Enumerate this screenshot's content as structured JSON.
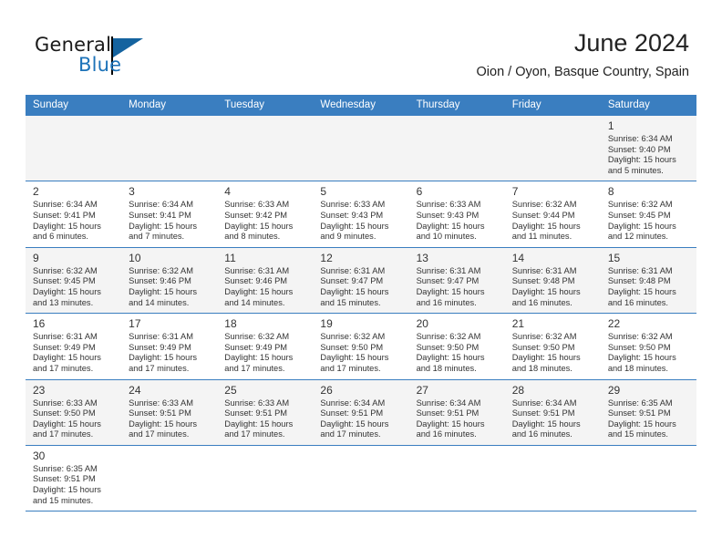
{
  "brand": {
    "word_one": "General",
    "word_two": "Blue",
    "flag_icon": "flag-icon"
  },
  "header": {
    "title": "June 2024",
    "subtitle": "Oion / Oyon, Basque Country, Spain"
  },
  "colors": {
    "header_blue": "#3a7ec0",
    "brand_blue": "#1c72b8",
    "alt_row": "#f4f4f4",
    "text": "#333333"
  },
  "calendar": {
    "weekday_headers": [
      "Sunday",
      "Monday",
      "Tuesday",
      "Wednesday",
      "Thursday",
      "Friday",
      "Saturday"
    ],
    "weeks": [
      [
        {
          "day": "",
          "sunrise": "",
          "sunset": "",
          "daylight_1": "",
          "daylight_2": ""
        },
        {
          "day": "",
          "sunrise": "",
          "sunset": "",
          "daylight_1": "",
          "daylight_2": ""
        },
        {
          "day": "",
          "sunrise": "",
          "sunset": "",
          "daylight_1": "",
          "daylight_2": ""
        },
        {
          "day": "",
          "sunrise": "",
          "sunset": "",
          "daylight_1": "",
          "daylight_2": ""
        },
        {
          "day": "",
          "sunrise": "",
          "sunset": "",
          "daylight_1": "",
          "daylight_2": ""
        },
        {
          "day": "",
          "sunrise": "",
          "sunset": "",
          "daylight_1": "",
          "daylight_2": ""
        },
        {
          "day": "1",
          "sunrise": "Sunrise: 6:34 AM",
          "sunset": "Sunset: 9:40 PM",
          "daylight_1": "Daylight: 15 hours",
          "daylight_2": "and 5 minutes."
        }
      ],
      [
        {
          "day": "2",
          "sunrise": "Sunrise: 6:34 AM",
          "sunset": "Sunset: 9:41 PM",
          "daylight_1": "Daylight: 15 hours",
          "daylight_2": "and 6 minutes."
        },
        {
          "day": "3",
          "sunrise": "Sunrise: 6:34 AM",
          "sunset": "Sunset: 9:41 PM",
          "daylight_1": "Daylight: 15 hours",
          "daylight_2": "and 7 minutes."
        },
        {
          "day": "4",
          "sunrise": "Sunrise: 6:33 AM",
          "sunset": "Sunset: 9:42 PM",
          "daylight_1": "Daylight: 15 hours",
          "daylight_2": "and 8 minutes."
        },
        {
          "day": "5",
          "sunrise": "Sunrise: 6:33 AM",
          "sunset": "Sunset: 9:43 PM",
          "daylight_1": "Daylight: 15 hours",
          "daylight_2": "and 9 minutes."
        },
        {
          "day": "6",
          "sunrise": "Sunrise: 6:33 AM",
          "sunset": "Sunset: 9:43 PM",
          "daylight_1": "Daylight: 15 hours",
          "daylight_2": "and 10 minutes."
        },
        {
          "day": "7",
          "sunrise": "Sunrise: 6:32 AM",
          "sunset": "Sunset: 9:44 PM",
          "daylight_1": "Daylight: 15 hours",
          "daylight_2": "and 11 minutes."
        },
        {
          "day": "8",
          "sunrise": "Sunrise: 6:32 AM",
          "sunset": "Sunset: 9:45 PM",
          "daylight_1": "Daylight: 15 hours",
          "daylight_2": "and 12 minutes."
        }
      ],
      [
        {
          "day": "9",
          "sunrise": "Sunrise: 6:32 AM",
          "sunset": "Sunset: 9:45 PM",
          "daylight_1": "Daylight: 15 hours",
          "daylight_2": "and 13 minutes."
        },
        {
          "day": "10",
          "sunrise": "Sunrise: 6:32 AM",
          "sunset": "Sunset: 9:46 PM",
          "daylight_1": "Daylight: 15 hours",
          "daylight_2": "and 14 minutes."
        },
        {
          "day": "11",
          "sunrise": "Sunrise: 6:31 AM",
          "sunset": "Sunset: 9:46 PM",
          "daylight_1": "Daylight: 15 hours",
          "daylight_2": "and 14 minutes."
        },
        {
          "day": "12",
          "sunrise": "Sunrise: 6:31 AM",
          "sunset": "Sunset: 9:47 PM",
          "daylight_1": "Daylight: 15 hours",
          "daylight_2": "and 15 minutes."
        },
        {
          "day": "13",
          "sunrise": "Sunrise: 6:31 AM",
          "sunset": "Sunset: 9:47 PM",
          "daylight_1": "Daylight: 15 hours",
          "daylight_2": "and 16 minutes."
        },
        {
          "day": "14",
          "sunrise": "Sunrise: 6:31 AM",
          "sunset": "Sunset: 9:48 PM",
          "daylight_1": "Daylight: 15 hours",
          "daylight_2": "and 16 minutes."
        },
        {
          "day": "15",
          "sunrise": "Sunrise: 6:31 AM",
          "sunset": "Sunset: 9:48 PM",
          "daylight_1": "Daylight: 15 hours",
          "daylight_2": "and 16 minutes."
        }
      ],
      [
        {
          "day": "16",
          "sunrise": "Sunrise: 6:31 AM",
          "sunset": "Sunset: 9:49 PM",
          "daylight_1": "Daylight: 15 hours",
          "daylight_2": "and 17 minutes."
        },
        {
          "day": "17",
          "sunrise": "Sunrise: 6:31 AM",
          "sunset": "Sunset: 9:49 PM",
          "daylight_1": "Daylight: 15 hours",
          "daylight_2": "and 17 minutes."
        },
        {
          "day": "18",
          "sunrise": "Sunrise: 6:32 AM",
          "sunset": "Sunset: 9:49 PM",
          "daylight_1": "Daylight: 15 hours",
          "daylight_2": "and 17 minutes."
        },
        {
          "day": "19",
          "sunrise": "Sunrise: 6:32 AM",
          "sunset": "Sunset: 9:50 PM",
          "daylight_1": "Daylight: 15 hours",
          "daylight_2": "and 17 minutes."
        },
        {
          "day": "20",
          "sunrise": "Sunrise: 6:32 AM",
          "sunset": "Sunset: 9:50 PM",
          "daylight_1": "Daylight: 15 hours",
          "daylight_2": "and 18 minutes."
        },
        {
          "day": "21",
          "sunrise": "Sunrise: 6:32 AM",
          "sunset": "Sunset: 9:50 PM",
          "daylight_1": "Daylight: 15 hours",
          "daylight_2": "and 18 minutes."
        },
        {
          "day": "22",
          "sunrise": "Sunrise: 6:32 AM",
          "sunset": "Sunset: 9:50 PM",
          "daylight_1": "Daylight: 15 hours",
          "daylight_2": "and 18 minutes."
        }
      ],
      [
        {
          "day": "23",
          "sunrise": "Sunrise: 6:33 AM",
          "sunset": "Sunset: 9:50 PM",
          "daylight_1": "Daylight: 15 hours",
          "daylight_2": "and 17 minutes."
        },
        {
          "day": "24",
          "sunrise": "Sunrise: 6:33 AM",
          "sunset": "Sunset: 9:51 PM",
          "daylight_1": "Daylight: 15 hours",
          "daylight_2": "and 17 minutes."
        },
        {
          "day": "25",
          "sunrise": "Sunrise: 6:33 AM",
          "sunset": "Sunset: 9:51 PM",
          "daylight_1": "Daylight: 15 hours",
          "daylight_2": "and 17 minutes."
        },
        {
          "day": "26",
          "sunrise": "Sunrise: 6:34 AM",
          "sunset": "Sunset: 9:51 PM",
          "daylight_1": "Daylight: 15 hours",
          "daylight_2": "and 17 minutes."
        },
        {
          "day": "27",
          "sunrise": "Sunrise: 6:34 AM",
          "sunset": "Sunset: 9:51 PM",
          "daylight_1": "Daylight: 15 hours",
          "daylight_2": "and 16 minutes."
        },
        {
          "day": "28",
          "sunrise": "Sunrise: 6:34 AM",
          "sunset": "Sunset: 9:51 PM",
          "daylight_1": "Daylight: 15 hours",
          "daylight_2": "and 16 minutes."
        },
        {
          "day": "29",
          "sunrise": "Sunrise: 6:35 AM",
          "sunset": "Sunset: 9:51 PM",
          "daylight_1": "Daylight: 15 hours",
          "daylight_2": "and 15 minutes."
        }
      ],
      [
        {
          "day": "30",
          "sunrise": "Sunrise: 6:35 AM",
          "sunset": "Sunset: 9:51 PM",
          "daylight_1": "Daylight: 15 hours",
          "daylight_2": "and 15 minutes."
        },
        {
          "day": "",
          "sunrise": "",
          "sunset": "",
          "daylight_1": "",
          "daylight_2": ""
        },
        {
          "day": "",
          "sunrise": "",
          "sunset": "",
          "daylight_1": "",
          "daylight_2": ""
        },
        {
          "day": "",
          "sunrise": "",
          "sunset": "",
          "daylight_1": "",
          "daylight_2": ""
        },
        {
          "day": "",
          "sunrise": "",
          "sunset": "",
          "daylight_1": "",
          "daylight_2": ""
        },
        {
          "day": "",
          "sunrise": "",
          "sunset": "",
          "daylight_1": "",
          "daylight_2": ""
        },
        {
          "day": "",
          "sunrise": "",
          "sunset": "",
          "daylight_1": "",
          "daylight_2": ""
        }
      ]
    ]
  }
}
